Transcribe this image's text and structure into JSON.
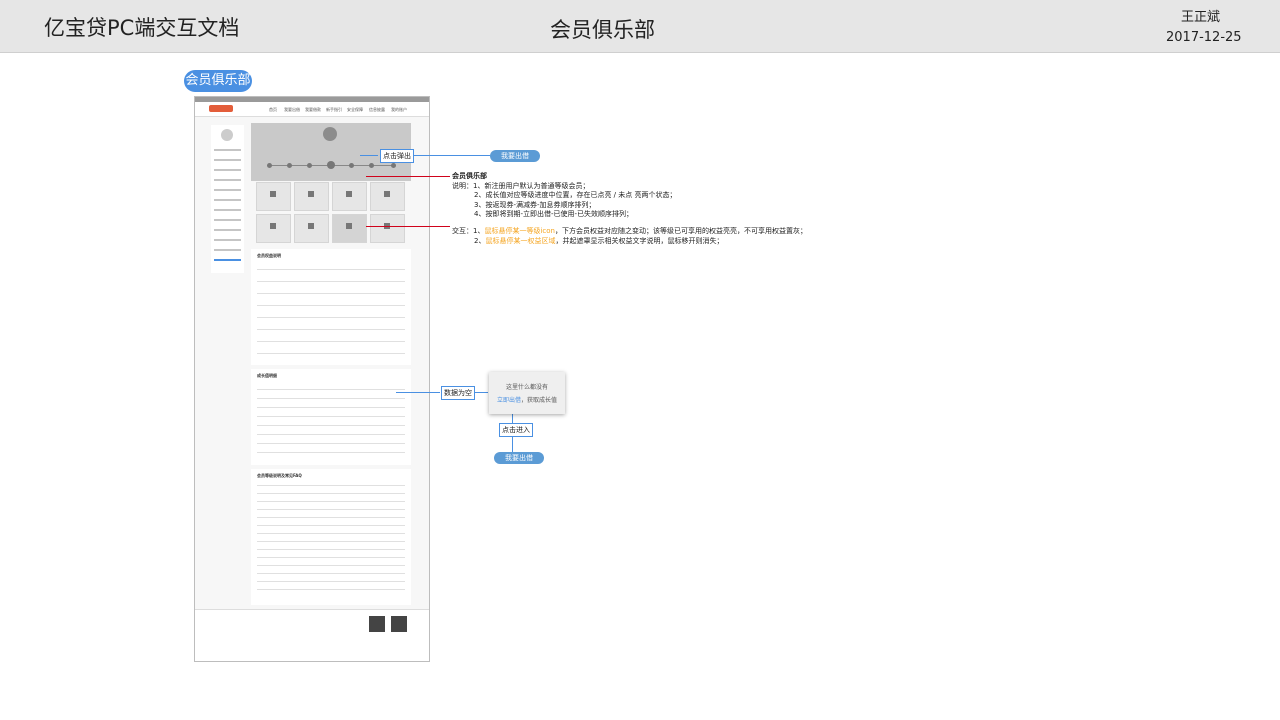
{
  "header": {
    "doc_title": "亿宝贷PC端交互文档",
    "page_title": "会员俱乐部",
    "author": "王正斌",
    "date": "2017-12-25"
  },
  "section_tag": "会员俱乐部",
  "annotations": {
    "popup_tag": "点击弹出",
    "popup_button": "我要出借",
    "empty_tag": "数据为空",
    "enter_tag": "点击进入",
    "enter_button": "我要出借"
  },
  "empty_state": {
    "title": "这里什么都没有",
    "link": "立即出借",
    "suffix": "，获取成长值"
  },
  "notes": {
    "heading": "会员俱乐部",
    "desc_label": "说明：",
    "desc": [
      "1、新注册用户默认为普通等级会员；",
      "2、成长值对应等级进度中位置，存在已点亮 / 未点 亮两个状态；",
      "3、按返现券-满减券-加息券顺序排列；",
      "4、按即将到期-立即出借-已使用-已失效顺序排列；"
    ],
    "interact_label": "交互：",
    "interact": [
      {
        "num": "1、",
        "highlight": "鼠标悬停某一等级icon",
        "rest": "，下方会员权益对应随之变动；该等级已可享用的权益亮亮，不可享用权益置灰；"
      },
      {
        "num": "2、",
        "highlight": "鼠标悬停某一权益区域",
        "rest": "，并起遮罩显示相关权益文字说明，鼠标移开则消失；"
      }
    ]
  },
  "mockup": {
    "nav_items": [
      "首页",
      "我要出借",
      "我要借款",
      "新手指引",
      "安全保障",
      "信息披露",
      "我的账户"
    ],
    "section_rights": "会员权益说明",
    "section_growth": "成长值明细",
    "section_faq": "会员等级说明及常见FAQ"
  },
  "colors": {
    "accent": "#4a90e2",
    "highlight": "#f5a623",
    "alert": "#d0021b"
  }
}
